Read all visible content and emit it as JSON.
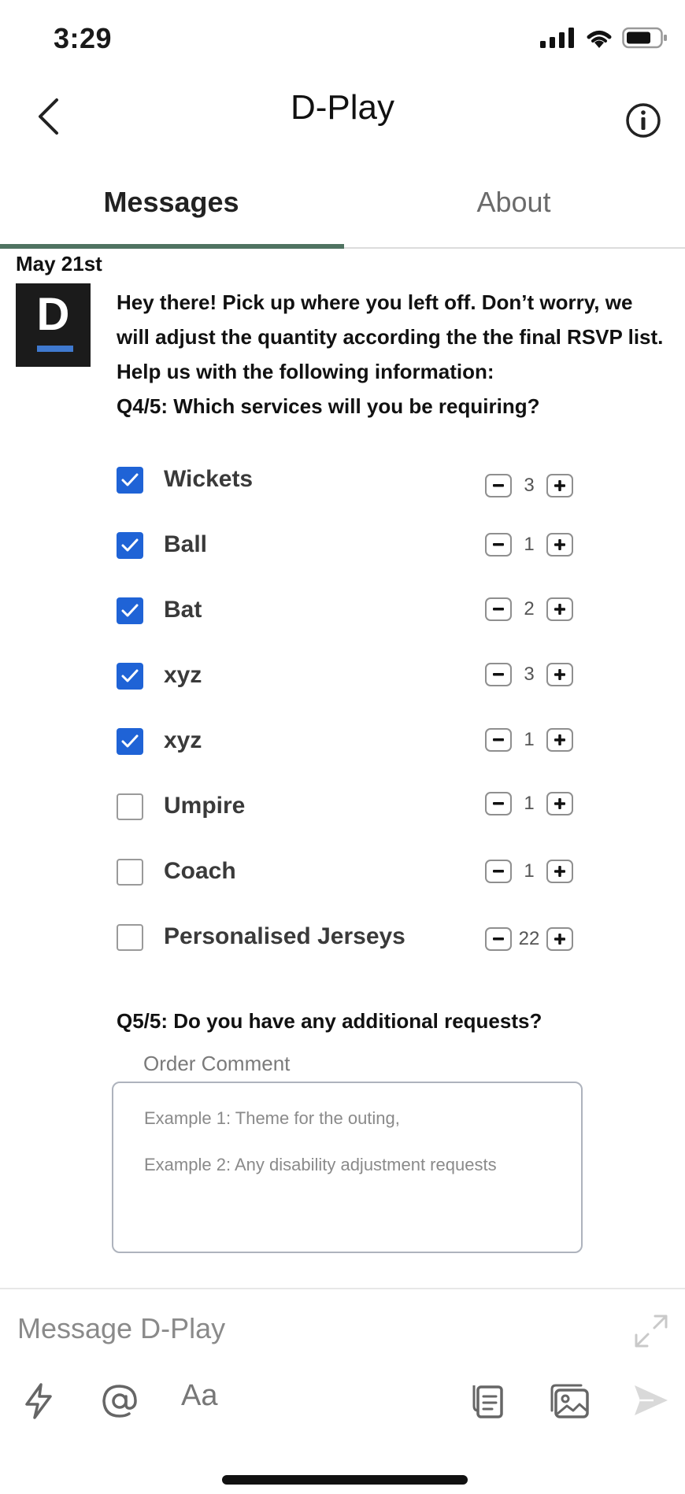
{
  "status_bar": {
    "time": "3:29"
  },
  "header": {
    "title": "D-Play"
  },
  "tabs": [
    {
      "label": "Messages",
      "active": true
    },
    {
      "label": "About",
      "active": false
    }
  ],
  "date_divider": "May 21st",
  "avatar": {
    "letter": "D"
  },
  "message": {
    "lines": [
      "Hey there! Pick up where you left off. Don’t worry, we",
      "will adjust the quantity according the the final RSVP list.",
      "Help us with the following information:",
      "Q4/5: Which services will you be requiring?"
    ]
  },
  "services": [
    {
      "label": "Wickets",
      "checked": true,
      "qty": "3"
    },
    {
      "label": "Ball",
      "checked": true,
      "qty": "1"
    },
    {
      "label": "Bat",
      "checked": true,
      "qty": "2"
    },
    {
      "label": "xyz",
      "checked": true,
      "qty": "3"
    },
    {
      "label": "xyz",
      "checked": true,
      "qty": "1"
    },
    {
      "label": "Umpire",
      "checked": false,
      "qty": "1"
    },
    {
      "label": "Coach",
      "checked": false,
      "qty": "1"
    },
    {
      "label": "Personalised Jerseys",
      "checked": false,
      "qty": "22"
    }
  ],
  "question5": "Q5/5: Do you have any additional requests?",
  "order_comment": {
    "label": "Order Comment",
    "placeholder_line1": "Example 1: Theme for the outing,",
    "placeholder_line2": "Example 2: Any disability adjustment requests"
  },
  "composer": {
    "placeholder": "Message D-Play",
    "format_label": "Aa"
  },
  "colors": {
    "accent": "#1f63d6",
    "tab_indicator": "#4f7361",
    "avatar_bar": "#3f79cf"
  },
  "icons": [
    "back-chevron-icon",
    "info-icon",
    "lightning-icon",
    "at-icon",
    "clipboard-icon",
    "gallery-icon",
    "send-icon",
    "expand-icon"
  ]
}
